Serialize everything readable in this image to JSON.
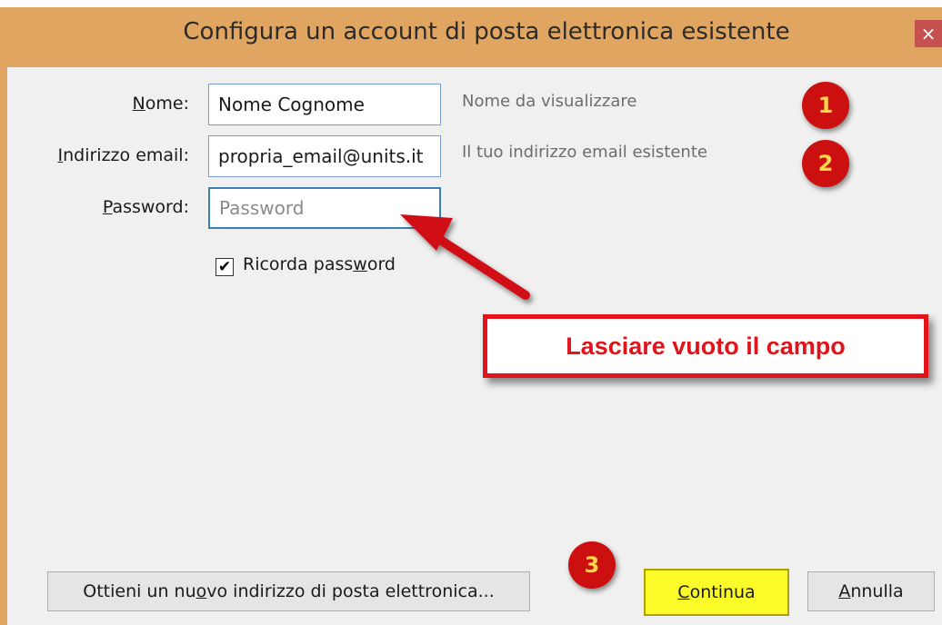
{
  "window": {
    "title": "Configura un account di posta elettronica esistente",
    "close_glyph": "×"
  },
  "form": {
    "name": {
      "label_u": "N",
      "label_rest": "ome:",
      "value": "Nome Cognome",
      "hint": "Nome da visualizzare"
    },
    "email": {
      "label_u": "I",
      "label_rest": "ndirizzo email:",
      "value": "propria_email@units.it",
      "hint": "Il tuo indirizzo email esistente"
    },
    "password": {
      "label_u": "P",
      "label_rest": "assword:",
      "value": "",
      "placeholder": "Password"
    },
    "remember": {
      "label_before": "Ricorda pass",
      "label_u": "w",
      "label_after": "ord",
      "checked": true,
      "check_glyph": "✔"
    }
  },
  "annotations": {
    "badge_1": "1",
    "badge_2": "2",
    "badge_3": "3",
    "callout": "Lasciare vuoto il campo"
  },
  "buttons": {
    "new_address": {
      "before": "Ottieni un nu",
      "u": "o",
      "after": "vo indirizzo di posta elettronica..."
    },
    "continue": {
      "u": "C",
      "rest": "ontinua"
    },
    "cancel": {
      "u": "A",
      "rest": "nnulla"
    }
  },
  "colors": {
    "titlebar": "#e0a560",
    "accent_red": "#e0141a",
    "highlight_yellow": "#fbfb2a"
  }
}
